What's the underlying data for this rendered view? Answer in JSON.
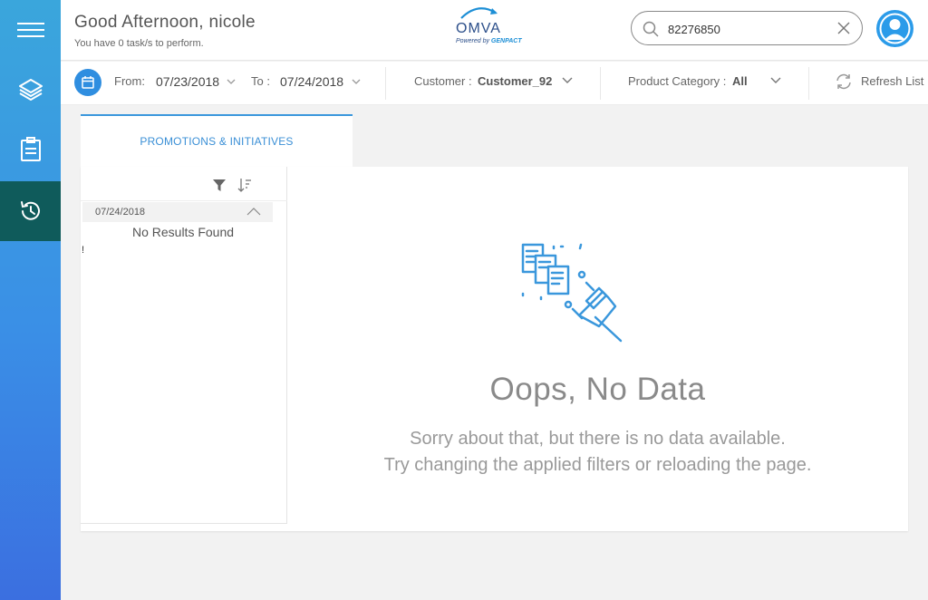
{
  "header": {
    "greeting": "Good Afternoon, nicole",
    "subtitle": "You have 0 task/s to perform.",
    "logo_name": "OMVA",
    "logo_powered": "Powered by",
    "logo_brand": "GENPACT",
    "search_value": "82276850"
  },
  "filters": {
    "from_label": "From:",
    "from_value": "07/23/2018",
    "to_label": "To :",
    "to_value": "07/24/2018",
    "customer_label": "Customer :",
    "customer_value": "Customer_92",
    "category_label": "Product Category :",
    "category_value": "All",
    "refresh_label": "Refresh List"
  },
  "tabs": [
    {
      "label": "PROMOTIONS & INITIATIVES",
      "active": true
    }
  ],
  "list": {
    "group_date": "07/24/2018",
    "no_results": "No Results Found",
    "stray_char": "!"
  },
  "empty_state": {
    "title": "Oops, No Data",
    "line1": "Sorry about that, but there is no data available.",
    "line2": "Try changing the applied filters or reloading the page."
  },
  "icons": {
    "sidebar": [
      "menu-icon",
      "layers-icon",
      "clipboard-icon",
      "history-icon"
    ],
    "active_sidebar": "history-icon"
  },
  "colors": {
    "accent": "#2f8ee0",
    "active_sidebar": "#0f5b5b",
    "tab_text": "#3a8fd6"
  }
}
